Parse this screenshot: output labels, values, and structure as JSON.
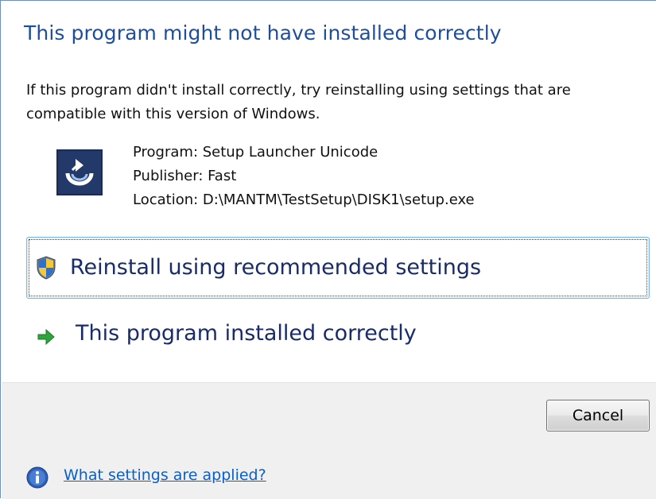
{
  "dialog": {
    "main_instruction": "This program might not have installed correctly",
    "content_text": "If this program didn't install correctly, try reinstalling using settings that are compatible with this version of Windows.",
    "program_icon": "setup-launcher-icon",
    "program_info": {
      "program": "Program: Setup Launcher Unicode",
      "publisher": "Publisher: Fast",
      "location": "Location: D:\\MANTM\\TestSetup\\DISK1\\setup.exe"
    },
    "command_links": [
      {
        "label": "Reinstall using recommended settings",
        "icon": "uac-shield-icon"
      },
      {
        "label": "This program installed correctly",
        "icon": "green-arrow-icon"
      }
    ],
    "buttons": {
      "cancel_label": "Cancel"
    },
    "footer": {
      "icon": "info-icon",
      "link_text": "What settings are applied?"
    }
  },
  "colors": {
    "instruction_blue": "#1e4e9c",
    "command_text": "#1a2c68",
    "link_blue": "#0a5fcc",
    "band_gray": "#f0f0f0",
    "focus_border": "#7db8e5"
  }
}
